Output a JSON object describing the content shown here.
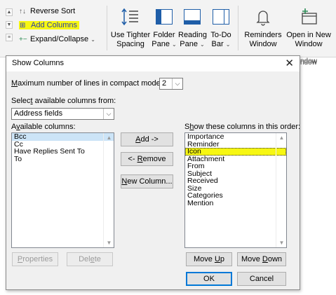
{
  "ribbon": {
    "reverse_sort": "Reverse Sort",
    "add_columns": "Add Columns",
    "expand_collapse": "Expand/Collapse",
    "tighter_spacing": [
      "Use Tighter",
      "Spacing"
    ],
    "folder_pane": [
      "Folder",
      "Pane"
    ],
    "reading_pane": [
      "Reading",
      "Pane"
    ],
    "todo_bar": [
      "To-Do",
      "Bar"
    ],
    "reminders_window": [
      "Reminders",
      "Window"
    ],
    "open_new_window": [
      "Open in New",
      "Window"
    ],
    "window_group_partial": "ndow",
    "highlight_color": "#f7f712"
  },
  "dialog": {
    "title": "Show Columns",
    "close_glyph": "✕",
    "max_lines_label": "aximum number of lines in compact mode:",
    "max_lines_accel": "M",
    "max_lines_value": "2",
    "select_from_label_pre": "Selec",
    "select_from_accel": "t",
    "select_from_label_post": " available columns from:",
    "select_from_value": "Address fields",
    "available_label_pre": "A",
    "available_accel": "v",
    "available_label_post": "ailable columns:",
    "available_columns": [
      "Bcc",
      "Cc",
      "Have Replies Sent To",
      "To"
    ],
    "show_label_pre": "S",
    "show_accel": "h",
    "show_label_post": "ow these columns in this order:",
    "shown_columns": [
      "Importance",
      "Reminder",
      "Icon",
      "Attachment",
      "From",
      "Subject",
      "Received",
      "Size",
      "Categories",
      "Mention"
    ],
    "buttons": {
      "add_accel": "A",
      "add_rest": "dd ->",
      "remove_pre": "<- ",
      "remove_accel": "R",
      "remove_rest": "emove",
      "new_column_accel": "N",
      "new_column_rest": "ew Column...",
      "properties_accel": "P",
      "properties_rest": "roperties",
      "delete_pre": "Del",
      "delete_accel": "e",
      "delete_rest": "te",
      "move_up_pre": "Move ",
      "move_up_accel": "U",
      "move_up_rest": "p",
      "move_down_pre": "Move ",
      "move_down_accel": "D",
      "move_down_rest": "own",
      "ok": "OK",
      "cancel": "Cancel"
    }
  },
  "colors": {
    "accent": "#1f5ea8",
    "selection": "#cce4f7",
    "focus_border": "#0078d7"
  }
}
